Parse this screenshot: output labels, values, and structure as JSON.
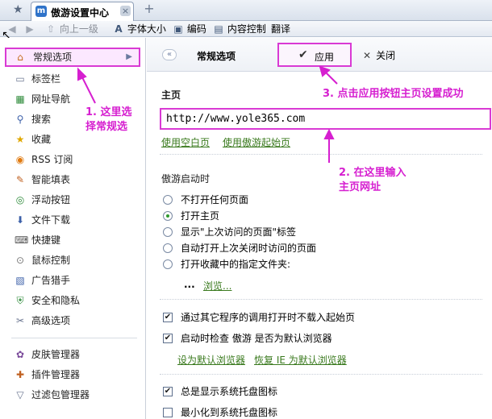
{
  "tabbar": {
    "tab_title": "傲游设置中心",
    "tab_icon": "maxthon-icon",
    "close_glyph": "×",
    "newtab_glyph": "+",
    "favorite_icon": "star-icon"
  },
  "toolbar": {
    "back": "back-arrow-icon",
    "forward": "forward-arrow-icon",
    "up_level": "向上一级",
    "font_size": "字体大小",
    "encoding": "编码",
    "content_control": "内容控制",
    "translate": "翻译"
  },
  "sidebar": {
    "items": [
      {
        "label": "常规选项",
        "icon": "home-icon"
      },
      {
        "label": "标签栏",
        "icon": "tab-icon"
      },
      {
        "label": "网址导航",
        "icon": "nav-icon"
      },
      {
        "label": "搜索",
        "icon": "search-icon"
      },
      {
        "label": "收藏",
        "icon": "star-icon"
      },
      {
        "label": "RSS 订阅",
        "icon": "rss-icon"
      },
      {
        "label": "智能填表",
        "icon": "form-fill-icon"
      },
      {
        "label": "浮动按钮",
        "icon": "floating-button-icon"
      },
      {
        "label": "文件下载",
        "icon": "download-icon"
      },
      {
        "label": "快捷键",
        "icon": "keyboard-icon"
      },
      {
        "label": "鼠标控制",
        "icon": "mouse-icon"
      },
      {
        "label": "广告猎手",
        "icon": "ad-hunter-icon"
      },
      {
        "label": "安全和隐私",
        "icon": "shield-icon"
      },
      {
        "label": "高级选项",
        "icon": "tools-icon"
      },
      {
        "label": "皮肤管理器",
        "icon": "skin-icon"
      },
      {
        "label": "插件管理器",
        "icon": "plugin-icon"
      },
      {
        "label": "过滤包管理器",
        "icon": "filter-icon"
      }
    ]
  },
  "main": {
    "title": "常规选项",
    "apply": "应用",
    "close": "关闭",
    "homepage_label": "主页",
    "homepage_url": "http://www.yole365.com",
    "use_blank": "使用空白页",
    "use_start": "使用傲游起始页",
    "startup_label": "傲游启动时",
    "startup_options": [
      {
        "label": "不打开任何页面",
        "selected": false
      },
      {
        "label": "打开主页",
        "selected": true
      },
      {
        "label": "显示\"上次访问的页面\"标签",
        "selected": false
      },
      {
        "label": "自动打开上次关闭时访问的页面",
        "selected": false
      },
      {
        "label": "打开收藏中的指定文件夹:",
        "selected": false
      }
    ],
    "folder_dots": "...",
    "browse": "浏览...",
    "checks_a": [
      {
        "label": "通过其它程序的调用打开时不载入起始页",
        "checked": true
      },
      {
        "label": "启动时检查 傲游 是否为默认浏览器",
        "checked": true
      }
    ],
    "set_default": "设为默认浏览器",
    "restore_ie": "恢复 IE 为默认浏览器",
    "checks_b": [
      {
        "label": "总是显示系统托盘图标",
        "checked": true
      },
      {
        "label": "最小化到系统托盘图标",
        "checked": false
      }
    ]
  },
  "annotations": {
    "step1_line1": "1. 这里选",
    "step1_line2": "择常规选",
    "step2_line1": "2. 在这里输入",
    "step2_line2": "主页网址",
    "step3": "3. 点击应用按钮主页设置成功"
  },
  "colors": {
    "highlight": "#d93ad4",
    "link": "#3a7a1e",
    "radio_on": "#2f9a2f"
  }
}
